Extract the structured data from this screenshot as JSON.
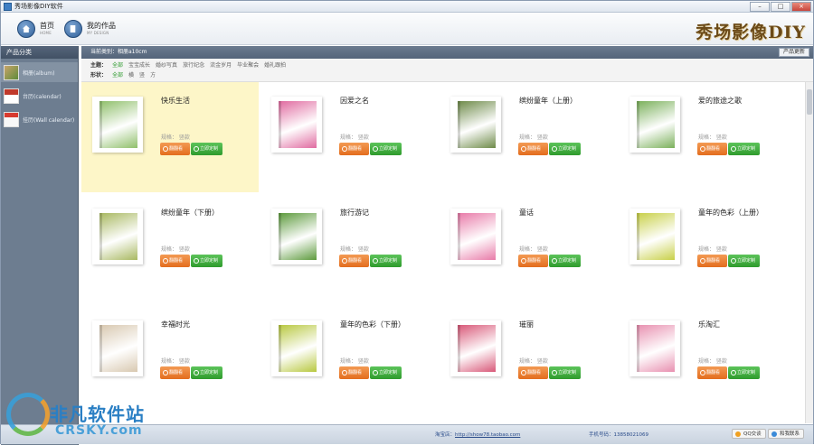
{
  "window": {
    "title": "秀场影像DIY软件",
    "controls": [
      "–",
      "□",
      "×"
    ]
  },
  "toolbar": {
    "home": {
      "label": "首页",
      "sub": "HOME",
      "icon": "home-icon"
    },
    "works": {
      "label": "我的作品",
      "sub": "MY DESIGN",
      "icon": "book-icon"
    },
    "brand": "秀场影像DIY"
  },
  "sidebar": {
    "title": "产品分类",
    "items": [
      {
        "label": "相册(album)",
        "icon": "album-thumb"
      },
      {
        "label": "台历(calendar)",
        "icon": "calendar-thumb"
      },
      {
        "label": "挂历(Wall calendar)",
        "icon": "wall-calendar-thumb"
      }
    ]
  },
  "main": {
    "current_category": "当前类别：相册a10cm",
    "more_button": "产品更新",
    "filters": {
      "topic_label": "主题：",
      "topics": [
        "全部",
        "宝宝成长",
        "婚纱写真",
        "旅行纪念",
        "流金岁月",
        "毕业聚会",
        "婚礼跟拍"
      ],
      "shape_label": "形状：",
      "shapes": [
        "全部",
        "横",
        "竖",
        "方"
      ]
    },
    "spec_text": "规格：  竖款",
    "view_button": "翻翻看",
    "custom_button": "立即定制",
    "products": [
      {
        "name": "快乐生活",
        "color": "#8fbf6a"
      },
      {
        "name": "因爱之名",
        "color": "#e06aa0"
      },
      {
        "name": "缤纷童年（上册）",
        "color": "#6d8a48"
      },
      {
        "name": "爱的旅途之歌",
        "color": "#7ab05a"
      },
      {
        "name": "缤纷童年（下册）",
        "color": "#a8b860"
      },
      {
        "name": "旅行游记",
        "color": "#5c9a3c"
      },
      {
        "name": "童话",
        "color": "#e87aa8"
      },
      {
        "name": "童年的色彩（上册）",
        "color": "#c8d048"
      },
      {
        "name": "幸福时光",
        "color": "#d8c8b0"
      },
      {
        "name": "童年的色彩（下册）",
        "color": "#b8c840"
      },
      {
        "name": "璀丽",
        "color": "#d85878"
      },
      {
        "name": "乐淘汇",
        "color": "#e890b0"
      }
    ]
  },
  "status": {
    "taobao_label": "淘宝店：",
    "taobao_value": "http://show78.taobao.com",
    "phone_label": "手机号码：",
    "phone_value": "13858021069",
    "qq_chat": "QQ交谈",
    "wangwang_chat": "和我联系"
  },
  "watermark": {
    "cn": "非凡软件站",
    "en": "CRSKY.com"
  }
}
